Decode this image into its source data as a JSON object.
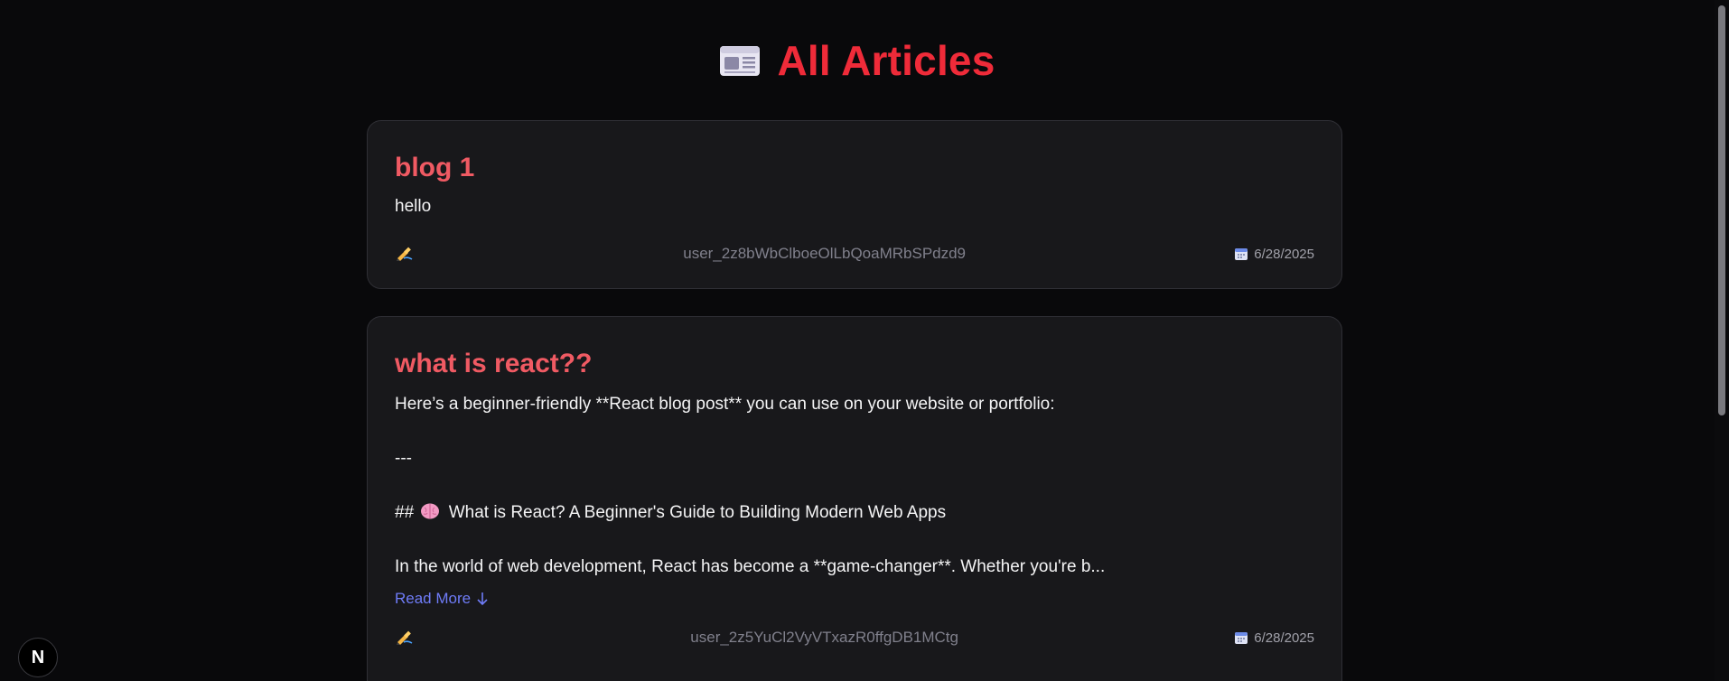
{
  "header": {
    "title": "All Articles",
    "icon": "newspaper-icon"
  },
  "articles": [
    {
      "title": "blog 1",
      "body": [
        "hello"
      ],
      "author_emoji": "writing-hand-icon",
      "author": "user_2z8bWbClboeOlLbQoaMRbSPdzd9",
      "date": "6/28/2025"
    },
    {
      "title": "what is react??",
      "body": [
        "Here’s a beginner-friendly **React blog post** you can use on your website or portfolio:",
        "---",
        "What is React? A Beginner's Guide to Building Modern Web Apps",
        "In the world of web development, React has become a **game-changer**. Whether you're b..."
      ],
      "heading_prefix": "##",
      "heading_icon": "brain-icon",
      "read_more": "Read More",
      "author_emoji": "writing-hand-icon",
      "author": "user_2z5YuCl2VyVTxazR0ffgDB1MCtg",
      "date": "6/28/2025"
    }
  ],
  "badge": {
    "label": "N"
  },
  "colors": {
    "background": "#09090b",
    "card": "#18181b",
    "title_red": "#ef2b39",
    "card_title": "#f05a63",
    "link": "#6f7cf8",
    "muted": "#80808c"
  }
}
